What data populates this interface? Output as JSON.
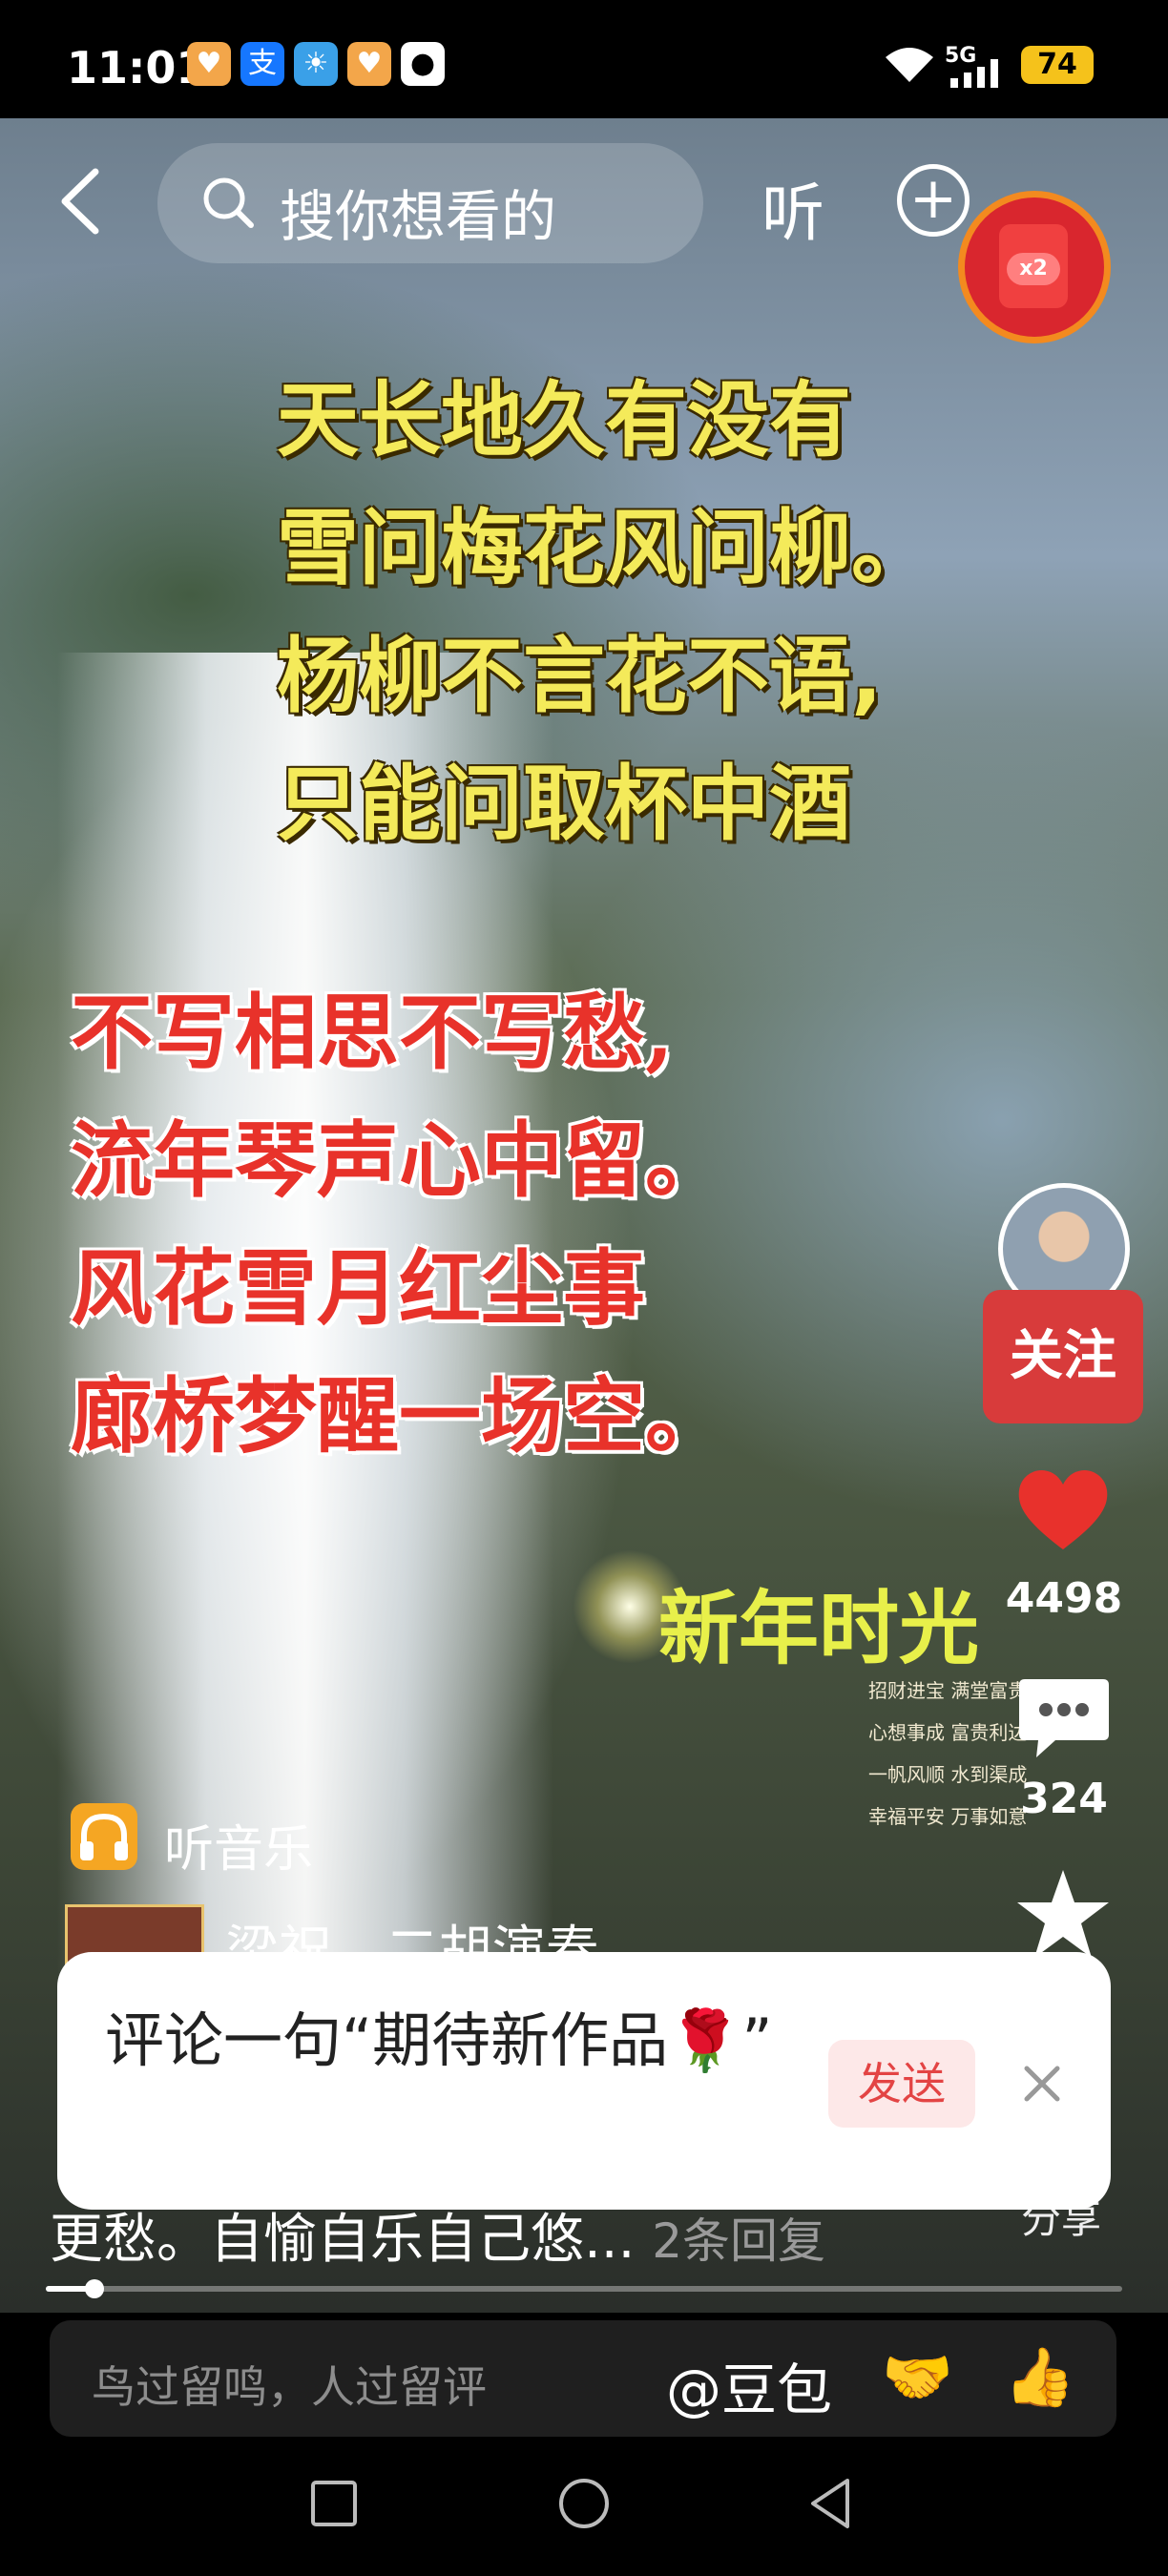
{
  "status_bar": {
    "time": "11:01",
    "network": "5G",
    "battery": "74",
    "app_icons": [
      "heart-app-icon",
      "alipay-icon",
      "weather-icon",
      "heart-app-icon",
      "qq-penguin-icon"
    ]
  },
  "top_bar": {
    "search_placeholder": "搜你想看的",
    "listen_label": "听",
    "red_packet_badge": "x2"
  },
  "poem": {
    "yellow_lines": [
      "天长地久有没有",
      "雪问梅花风问柳。",
      "杨柳不言花不语,",
      "只能问取杯中酒"
    ],
    "red_lines": [
      "不写相思不写愁,",
      "流年琴声心中留。",
      "风花雪月红尘事",
      "廊桥梦醒一场空。"
    ]
  },
  "video_overlay": {
    "caption_cn": "新年时光",
    "small_lines": [
      "招财进宝 满堂富贵",
      "心想事成 富贵利达",
      "一帆风顺 水到渠成",
      "幸福平安 万事如意"
    ]
  },
  "right_rail": {
    "follow_label": "关注",
    "like_count": "4498",
    "comment_count": "324",
    "share_label": "分享"
  },
  "music": {
    "label": "听音乐",
    "song_title": "梁祝 - 二胡演奏"
  },
  "comment_popup": {
    "text": "评论一句“期待新作品🌹”",
    "send_label": "发送"
  },
  "reply_row": {
    "text": "更愁。自愉自乐自己悠...",
    "reply_count": "2条回复"
  },
  "progress": {
    "fraction": 0.045
  },
  "input_bar": {
    "placeholder": "鸟过留鸣，人过留评",
    "at_label": "@豆包",
    "emoji_handshake": "🤝",
    "emoji_thumbs": "👍"
  },
  "colors": {
    "follow_red": "#d83b3b",
    "like_red": "#e8312c",
    "poem_yellow": "#f4ea5a",
    "poem_red": "#e8322a",
    "battery_yellow": "#f5c21b"
  }
}
